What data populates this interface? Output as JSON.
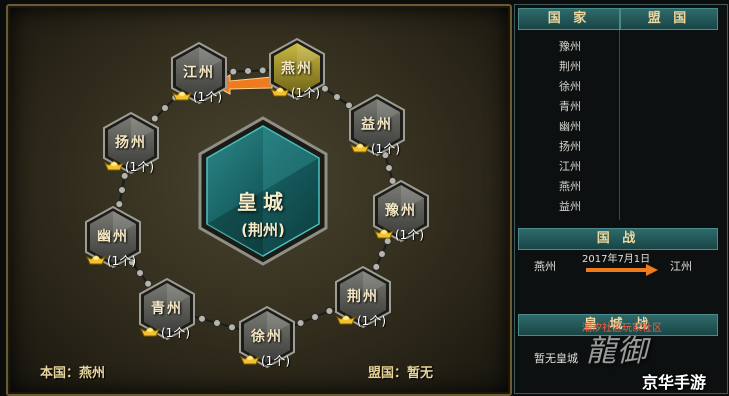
{
  "map": {
    "palace": {
      "name": "皇城",
      "sub": "(荆州)"
    },
    "cities": [
      {
        "name": "燕州",
        "count": "(1个)",
        "highlight": true
      },
      {
        "name": "益州",
        "count": "(1个)",
        "highlight": false
      },
      {
        "name": "豫州",
        "count": "(1个)",
        "highlight": false
      },
      {
        "name": "荆州",
        "count": "(1个)",
        "highlight": false
      },
      {
        "name": "徐州",
        "count": "(1个)",
        "highlight": false
      },
      {
        "name": "青州",
        "count": "(1个)",
        "highlight": false
      },
      {
        "name": "幽州",
        "count": "(1个)",
        "highlight": false
      },
      {
        "name": "扬州",
        "count": "(1个)",
        "highlight": false
      },
      {
        "name": "江州",
        "count": "(1个)",
        "highlight": false
      }
    ],
    "own_country": "本国：燕州",
    "ally": "盟国：暂无"
  },
  "panel": {
    "country_header": "国 家",
    "ally_header": "盟 国",
    "countries": [
      "豫州",
      "荆州",
      "徐州",
      "青州",
      "幽州",
      "扬州",
      "江州",
      "燕州",
      "益州"
    ],
    "war_header": "国 战",
    "war_from": "燕州",
    "war_date": "2017年7月1日",
    "war_to": "江州",
    "palace_war_header": "皇 城 战",
    "palace_war_text": "暂无皇城"
  },
  "watermark": {
    "community": "潮汐社区玩家社区",
    "site": "京华手游"
  },
  "colors": {
    "accent_gold": "#e8d49a",
    "highlight_hex": "#a89a2a",
    "attack_arrow": "#f07a1e",
    "panel_header": "#2e6b6b"
  }
}
